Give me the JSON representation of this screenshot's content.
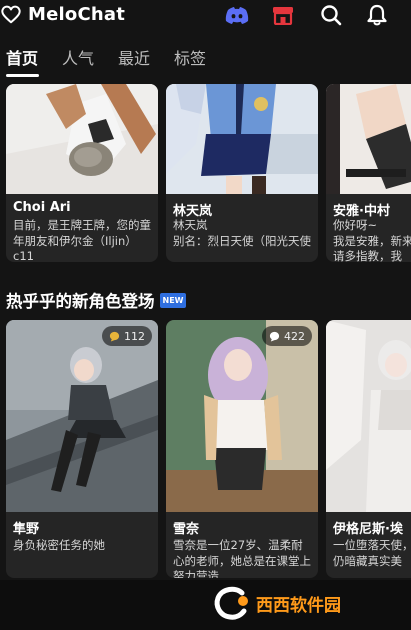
{
  "app": {
    "name": "MeloChat"
  },
  "header": {
    "icons": [
      "discord-icon",
      "store-icon",
      "search-icon",
      "bell-icon"
    ],
    "store_color": "#e5363d",
    "discord_color": "#5b6ef5"
  },
  "tabs": [
    {
      "label": "首页",
      "active": true
    },
    {
      "label": "人气",
      "active": false
    },
    {
      "label": "最近",
      "active": false
    },
    {
      "label": "标签",
      "active": false
    }
  ],
  "featured": [
    {
      "name": "Choi Ari",
      "desc": "目前，是王牌王牌，您的童年朋友和伊尔金（Iljin）c11"
    },
    {
      "name": "林天岚",
      "desc": "林天岚\n别名：烈日天使（阳光天使"
    },
    {
      "name": "安雅·中村",
      "desc": "你好呀~\n我是安雅，新来\n请多指教，我"
    }
  ],
  "new_section": {
    "title": "热乎乎的新角色登场",
    "new_tag": "NEW",
    "cards": [
      {
        "name": "隼野",
        "desc": "身负秘密任务的她",
        "count": "112"
      },
      {
        "name": "雪奈",
        "desc": "雪奈是一位27岁、温柔耐心的老师，她总是在课堂上努力营造",
        "count": "422"
      },
      {
        "name": "伊格尼斯·埃",
        "desc": "一位堕落天使，\n仍暗藏真实美",
        "count": ""
      }
    ]
  },
  "watermark": {
    "brand": "西西软件园",
    "accent": "#ff9a1a"
  }
}
